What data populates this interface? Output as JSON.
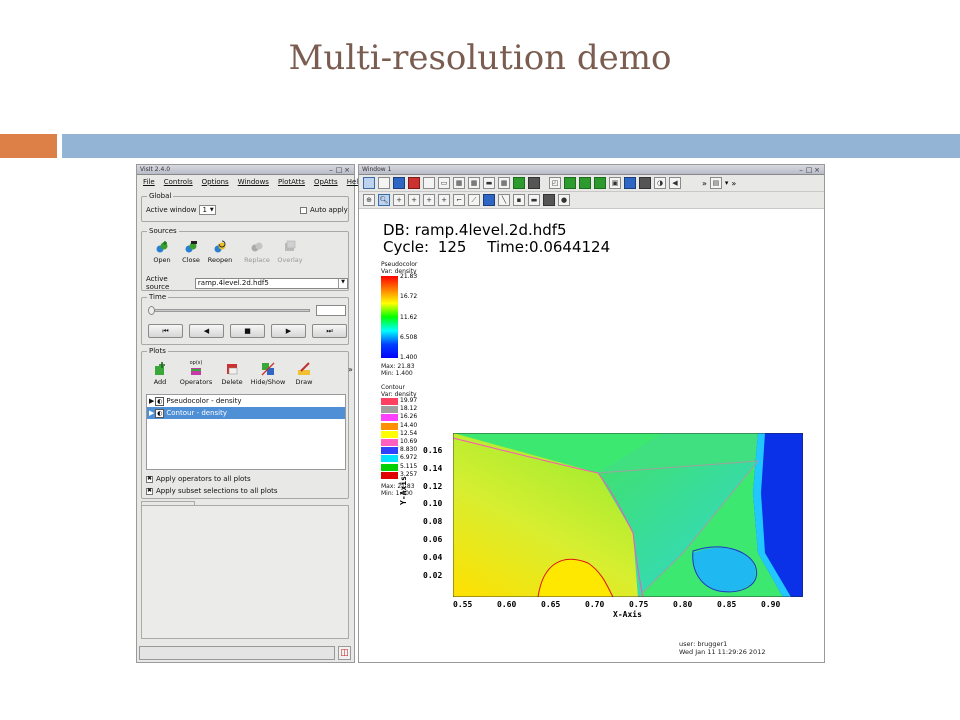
{
  "slide": {
    "title": "Multi-resolution demo",
    "accent_colors": {
      "orange": "#dd8048",
      "blue": "#93b4d4"
    }
  },
  "gui": {
    "window_title": "VisIt 2.4.0",
    "menu": [
      "File",
      "Controls",
      "Options",
      "Windows",
      "PlotAtts",
      "OpAtts",
      "Help"
    ],
    "global": {
      "group_label": "Global",
      "active_window_label": "Active window",
      "active_window_value": "1",
      "auto_apply_label": "Auto apply"
    },
    "sources": {
      "group_label": "Sources",
      "buttons": [
        {
          "label": "Open",
          "icon": "open-icon",
          "enabled": true
        },
        {
          "label": "Close",
          "icon": "close-source-icon",
          "enabled": true
        },
        {
          "label": "Reopen",
          "icon": "reopen-icon",
          "enabled": true
        },
        {
          "label": "Replace",
          "icon": "replace-icon",
          "enabled": false
        },
        {
          "label": "Overlay",
          "icon": "overlay-icon",
          "enabled": false
        }
      ],
      "active_source_label": "Active source",
      "active_source_value": "ramp.4level.2d.hdf5"
    },
    "time": {
      "group_label": "Time",
      "vcr_buttons": [
        "⏮",
        "◀",
        "■",
        "▶",
        "⏭"
      ]
    },
    "plots": {
      "group_label": "Plots",
      "buttons": [
        {
          "label": "Add",
          "icon": "add-plot-icon",
          "top": ""
        },
        {
          "label": "Operators",
          "icon": "operators-icon",
          "top": "op(s)"
        },
        {
          "label": "Delete",
          "icon": "delete-icon",
          "top": ""
        },
        {
          "label": "Hide/Show",
          "icon": "hide-show-icon",
          "top": ""
        },
        {
          "label": "Draw",
          "icon": "draw-icon",
          "top": ""
        }
      ],
      "more": "»",
      "list": [
        {
          "label": "Pseudocolor - density",
          "selected": false
        },
        {
          "label": "Contour - density",
          "selected": true
        }
      ],
      "apply_operators_label": "Apply operators to all plots",
      "apply_subset_label": "Apply subset selections to all plots"
    }
  },
  "viewer": {
    "window_title": "Window 1",
    "db_line": "DB: ramp.4level.2d.hdf5",
    "cycle_label": "Cycle:",
    "cycle_value": "125",
    "time_label": "Time:0.0644124",
    "pseudocolor_legend": {
      "title": "Pseudocolor",
      "var": "Var: density",
      "ticks": [
        "21.83",
        "16.72",
        "11.62",
        "6.508",
        "1.400"
      ],
      "max": "Max: 21.83",
      "min": "Min: 1.400"
    },
    "contour_legend": {
      "title": "Contour",
      "var": "Var: density",
      "levels": [
        {
          "value": "19.97",
          "color": "#ff4060"
        },
        {
          "value": "18.12",
          "color": "#a0a0a0"
        },
        {
          "value": "16.26",
          "color": "#ff40ff"
        },
        {
          "value": "14.40",
          "color": "#ff9000"
        },
        {
          "value": "12.54",
          "color": "#ffff00"
        },
        {
          "value": "10.69",
          "color": "#ff60c0"
        },
        {
          "value": "8.830",
          "color": "#3040ff"
        },
        {
          "value": "6.972",
          "color": "#00e0ff"
        },
        {
          "value": "5.115",
          "color": "#00d000"
        },
        {
          "value": "3.257",
          "color": "#e00000"
        }
      ],
      "max": "Max: 21.83",
      "min": "Min: 1.400"
    },
    "x_ticks": [
      "0.55",
      "0.60",
      "0.65",
      "0.70",
      "0.75",
      "0.80",
      "0.85",
      "0.90"
    ],
    "y_ticks": [
      "0.16",
      "0.14",
      "0.12",
      "0.10",
      "0.08",
      "0.06",
      "0.04",
      "0.02"
    ],
    "x_label": "X-Axis",
    "y_label": "Y-Axis",
    "user": "user: brugger1",
    "date": "Wed Jan 11 11:29:26 2012"
  }
}
